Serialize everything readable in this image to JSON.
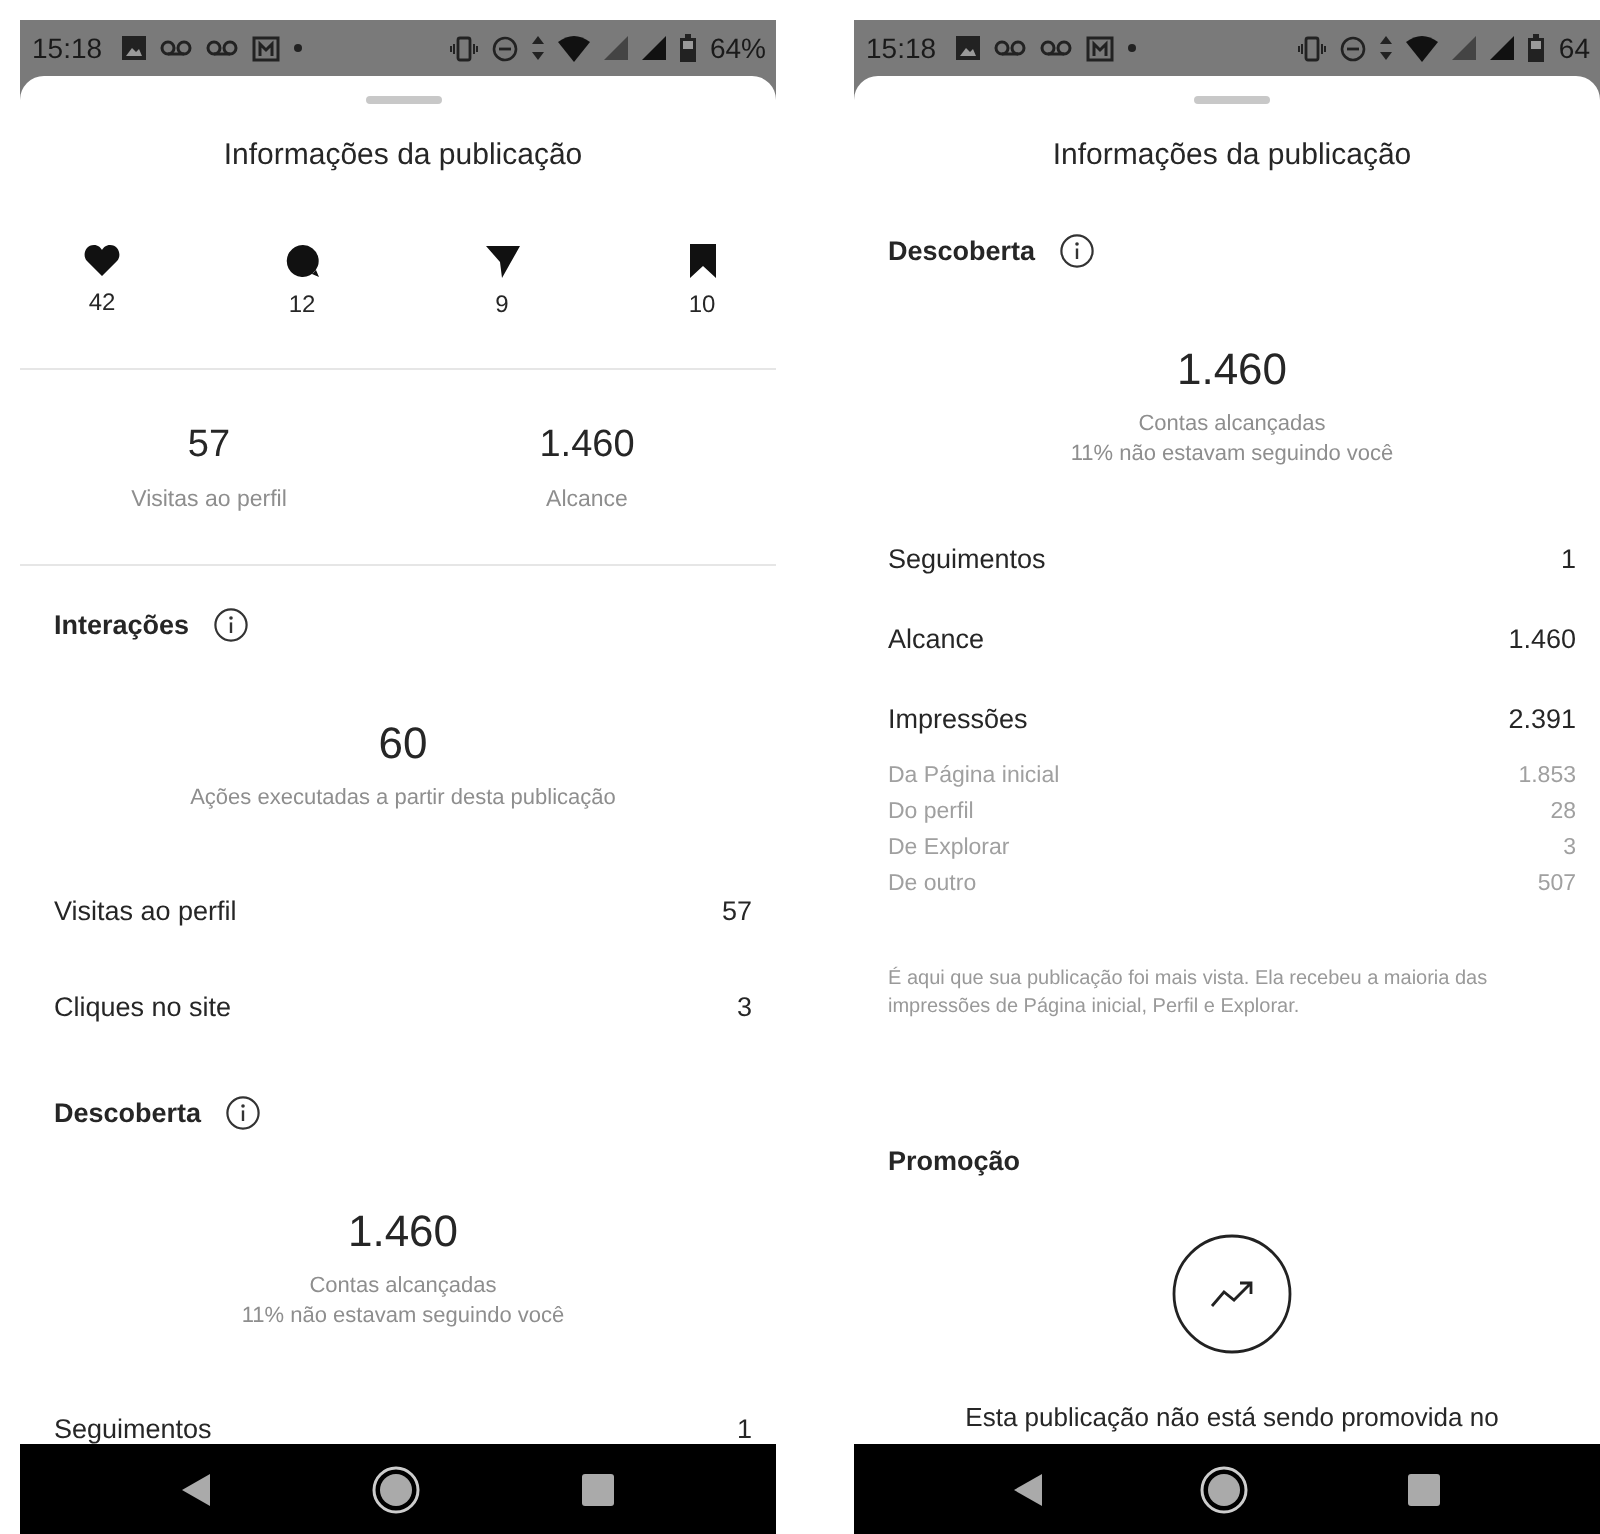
{
  "screens": [
    {
      "status_bar": {
        "time": "15:18",
        "battery": "64%"
      },
      "title": "Informações da publicação",
      "blocks": [
        {
          "kind": "icon_stats",
          "items": [
            {
              "kind": "likes",
              "value": "42"
            },
            {
              "kind": "comments",
              "value": "12"
            },
            {
              "kind": "shares",
              "value": "9"
            },
            {
              "kind": "saves",
              "value": "10"
            }
          ]
        },
        {
          "kind": "pair_stats",
          "items": [
            {
              "value": "57",
              "label": "Visitas ao perfil"
            },
            {
              "value": "1.460",
              "label": "Alcance"
            }
          ]
        },
        {
          "kind": "section",
          "title": "Interações",
          "info": true
        },
        {
          "kind": "summary",
          "value": "60",
          "captions": [
            "Ações executadas a partir desta publicação"
          ]
        },
        {
          "kind": "row",
          "label": "Visitas ao perfil",
          "value": "57"
        },
        {
          "kind": "row",
          "label": "Cliques no site",
          "value": "3"
        },
        {
          "kind": "section",
          "title": "Descoberta",
          "info": true
        },
        {
          "kind": "summary",
          "value": "1.460",
          "captions": [
            "Contas alcançadas",
            "11% não estavam seguindo você"
          ]
        },
        {
          "kind": "row",
          "label": "Seguimentos",
          "value": "1"
        }
      ]
    },
    {
      "status_bar": {
        "time": "15:18",
        "battery": "64"
      },
      "title": "Informações da publicação",
      "blocks": [
        {
          "kind": "section",
          "title": "Descoberta",
          "info": true
        },
        {
          "kind": "summary",
          "value": "1.460",
          "captions": [
            "Contas alcançadas",
            "11% não estavam seguindo você"
          ]
        },
        {
          "kind": "row",
          "label": "Seguimentos",
          "value": "1"
        },
        {
          "kind": "row",
          "label": "Alcance",
          "value": "1.460"
        },
        {
          "kind": "row",
          "label": "Impressões",
          "value": "2.391"
        },
        {
          "kind": "subrow",
          "label": "Da Página inicial",
          "value": "1.853"
        },
        {
          "kind": "subrow",
          "label": "Do perfil",
          "value": "28"
        },
        {
          "kind": "subrow",
          "label": "De Explorar",
          "value": "3"
        },
        {
          "kind": "subrow",
          "label": "De outro",
          "value": "507"
        },
        {
          "kind": "note",
          "text": "É aqui que sua publicação foi mais vista. Ela recebeu a maioria das impressões de Página inicial, Perfil e Explorar."
        },
        {
          "kind": "section",
          "title": "Promoção",
          "info": false
        },
        {
          "kind": "promo",
          "text": "Esta publicação não está sendo promovida no"
        }
      ]
    }
  ]
}
